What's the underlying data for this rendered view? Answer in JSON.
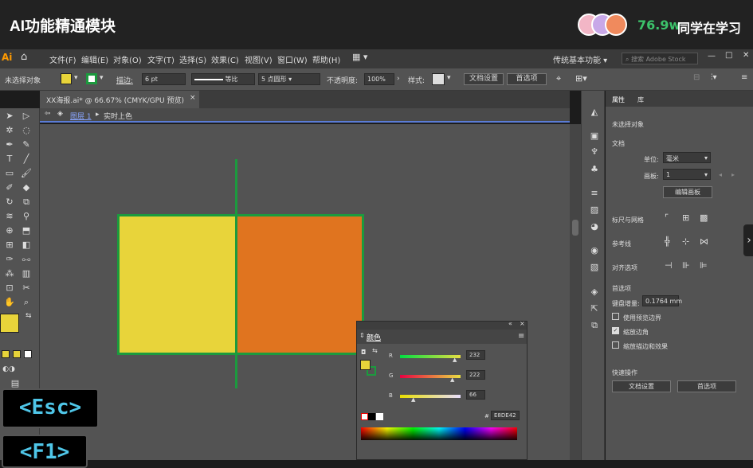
{
  "header": {
    "title": "AI功能精通模块",
    "learner_count": "76.9w",
    "learner_text": "同学在学习"
  },
  "app": {
    "logo": "Ai",
    "menu": [
      "文件(F)",
      "编辑(E)",
      "对象(O)",
      "文字(T)",
      "选择(S)",
      "效果(C)",
      "视图(V)",
      "窗口(W)",
      "帮助(H)"
    ],
    "workspace": "传统基本功能",
    "search_placeholder": "搜索 Adobe Stock"
  },
  "control": {
    "no_selection": "未选择对象",
    "stroke_label": "描边:",
    "stroke_value": "6 pt",
    "uniform": "等比",
    "brush": "5 点圆形",
    "opacity_label": "不透明度:",
    "opacity_value": "100%",
    "style_label": "样式:",
    "doc_setup": "文档设置",
    "preferences": "首选项"
  },
  "document": {
    "tab": "XX海报.ai* @ 66.67% (CMYK/GPU 预览)",
    "layer": "图层 1",
    "live_paint": "实时上色"
  },
  "properties": {
    "tab_props": "属性",
    "tab_lib": "库",
    "no_selection": "未选择对象",
    "document": "文档",
    "unit_label": "单位:",
    "unit_value": "毫米",
    "artboard_label": "画板:",
    "artboard_value": "1",
    "edit_artboard": "编辑画板",
    "rulers": "标尺与网格",
    "guides": "参考线",
    "snap": "对齐选项",
    "prefs": "首选项",
    "keyboard_label": "键盘增量:",
    "keyboard_value": "0.1764 mm",
    "preview_bounds": "使用预览边界",
    "scale_corners": "缩放边角",
    "scale_strokes": "缩放描边和效果",
    "quick_actions": "快速操作",
    "qa_doc": "文档设置",
    "qa_prefs": "首选项"
  },
  "color_panel": {
    "title": "颜色",
    "r_label": "R",
    "r_value": "232",
    "g_label": "G",
    "g_value": "222",
    "b_label": "B",
    "b_value": "66",
    "hex_label": "#",
    "hex_value": "E8DE42"
  },
  "keys": {
    "esc": "<Esc>",
    "f1": "<F1>"
  },
  "colors": {
    "yellow": "#e8d43a",
    "orange": "#e0741f",
    "stroke": "#1c9a3e",
    "accent_blue": "#5b7cd6",
    "count_green": "#3cc36b"
  }
}
